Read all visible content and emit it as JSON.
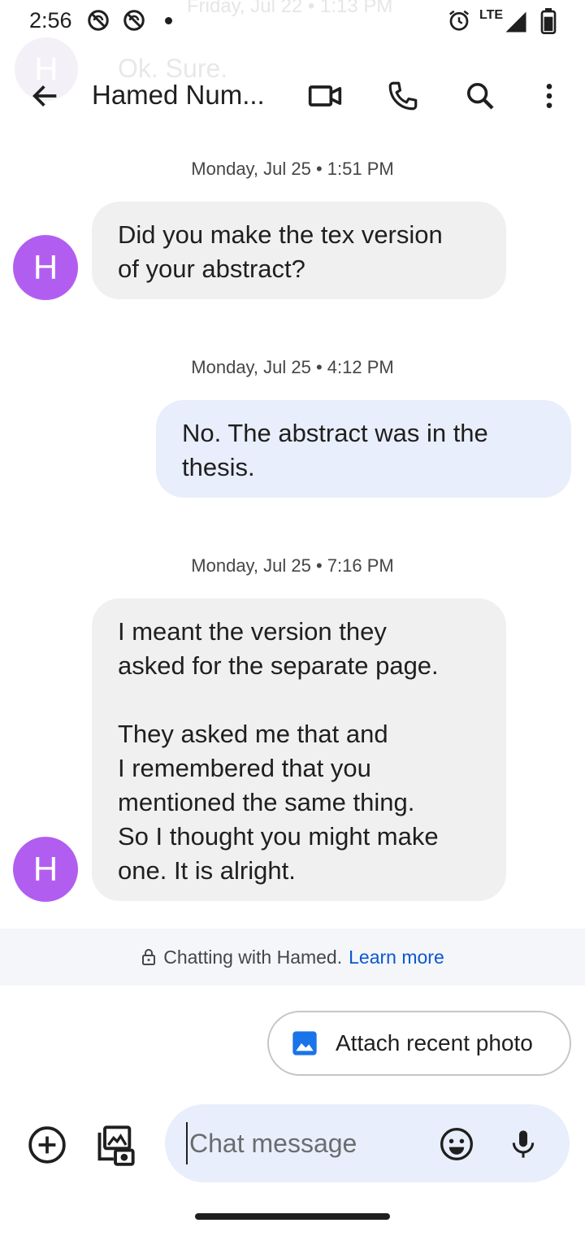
{
  "status_bar": {
    "time": "2:56",
    "network": "LTE",
    "ghost_text": "Friday, Jul 22 • 1:13 PM"
  },
  "ghost": {
    "avatar_letter": "H",
    "message": "Ok. Sure."
  },
  "header": {
    "title": "Hamed Num..."
  },
  "messages": [
    {
      "timestamp": "Monday, Jul 25 • 1:51 PM",
      "direction": "incoming",
      "avatar": "H",
      "text": "Did you make the tex version\nof your abstract?"
    },
    {
      "timestamp": "Monday, Jul 25 • 4:12 PM",
      "direction": "outgoing",
      "text": "No. The abstract was in the\nthesis."
    },
    {
      "timestamp": "Monday, Jul 25 • 7:16 PM",
      "direction": "incoming",
      "avatar": "H",
      "text": "I meant the version they\nasked for the separate page.\n\nThey asked me that and\nI remembered that you\nmentioned the same thing.\nSo I thought you might make\none. It is alright."
    }
  ],
  "banner": {
    "text": "Chatting with Hamed.",
    "link": "Learn more"
  },
  "chip": {
    "label": "Attach recent photo"
  },
  "compose": {
    "placeholder": "Chat message"
  },
  "colors": {
    "avatar": "#b15ef0",
    "incoming_bubble": "#f0f0f0",
    "outgoing_bubble": "#e8eefb",
    "link": "#0b57d0",
    "chip_icon": "#1a73e8"
  }
}
